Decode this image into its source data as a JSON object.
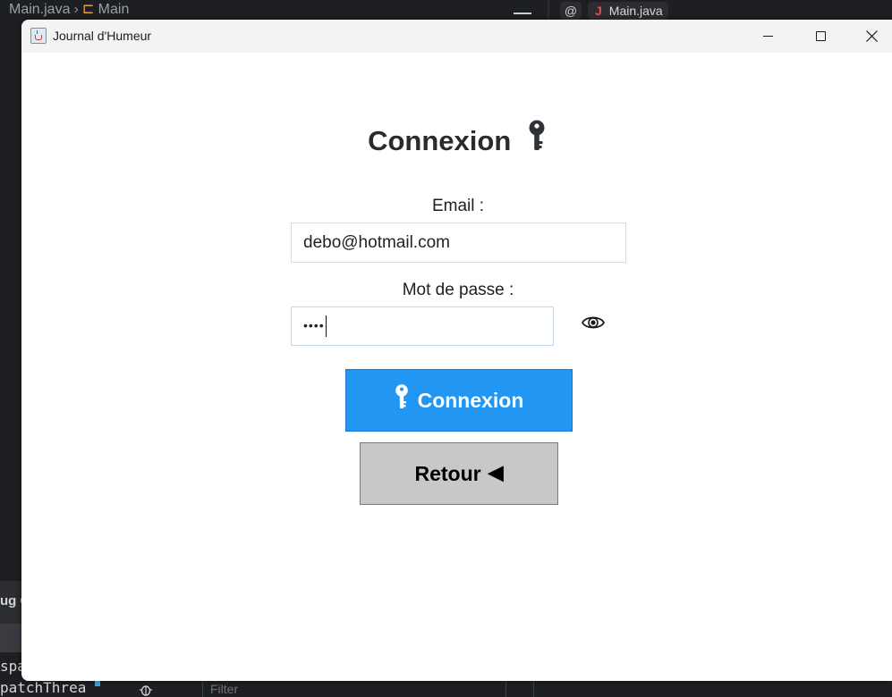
{
  "ide": {
    "tab_file": "Main.java",
    "tab_class": "Main",
    "right_tab_at": "@",
    "right_tab_file": "Main.java",
    "left_panel_text": "ug C",
    "code_lines": [
      "spa",
      "patchThrea"
    ],
    "filter_placeholder": "Filter"
  },
  "window": {
    "title": "Journal d'Humeur"
  },
  "login": {
    "heading": "Connexion",
    "email_label": "Email :",
    "email_value": "debo@hotmail.com",
    "password_label": "Mot de passe :",
    "password_masked": "••••",
    "login_button": "Connexion",
    "back_button": "Retour",
    "back_arrow": "◀"
  },
  "colors": {
    "primary_button": "#2196f3",
    "secondary_button": "#c8c8c8",
    "heading_text": "#2b2b2b"
  },
  "icons": {
    "heading": "key-icon",
    "login_button": "key-icon",
    "toggle_password": "eye-icon",
    "back_button": "left-arrow-icon"
  }
}
